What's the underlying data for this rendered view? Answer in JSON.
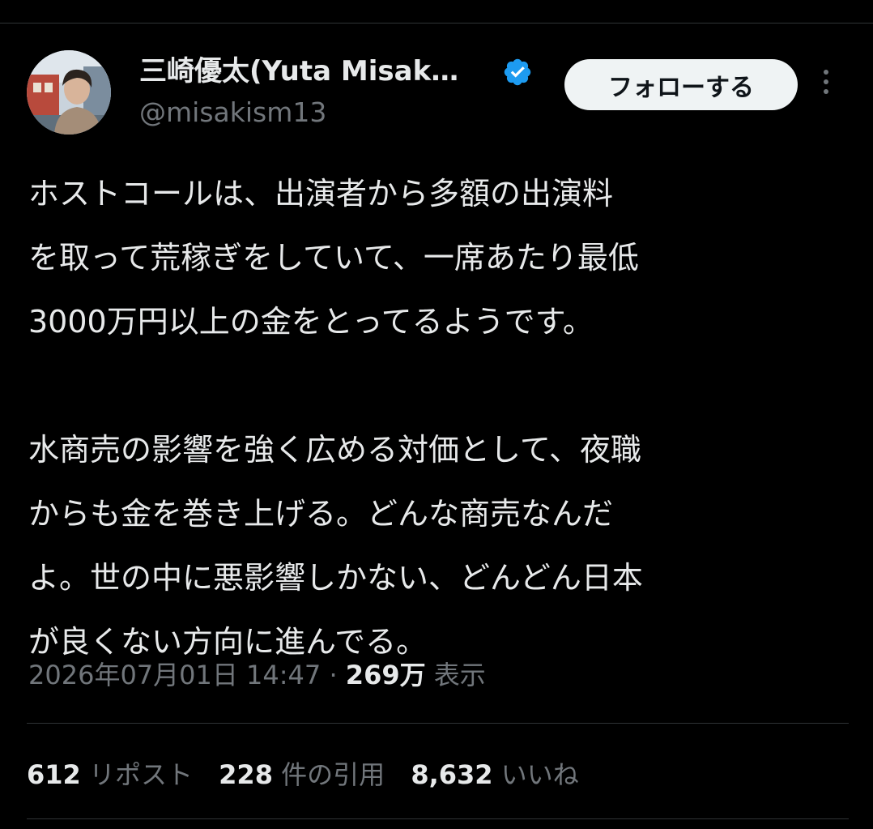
{
  "author": {
    "display_name": "三崎優太(Yuta Misak…",
    "handle": "@misakism13",
    "verified": true,
    "badge_color": "#1d9bf0"
  },
  "follow_button": {
    "label": "フォローする"
  },
  "tweet": {
    "paragraphs": [
      "ホストコールは、出演者から多額の出演料\nを取って荒稼ぎをしていて、一席あたり最低\n3000万円以上の金をとってるようです。",
      "水商売の影響を強く広める対価として、夜職\nからも金を巻き上げる。どんな商売なんだ\nよ。世の中に悪影響しかない、どんどん日本\nが良くない方向に進んでる。"
    ]
  },
  "meta": {
    "datetime": "2026年07月01日 14:47",
    "separator": "·",
    "views_count": "269万",
    "views_label": "表示"
  },
  "stats": {
    "reposts_count": "612",
    "reposts_label": "リポスト",
    "quotes_count": "228",
    "quotes_label": "件の引用",
    "likes_count": "8,632",
    "likes_label": "いいね"
  }
}
